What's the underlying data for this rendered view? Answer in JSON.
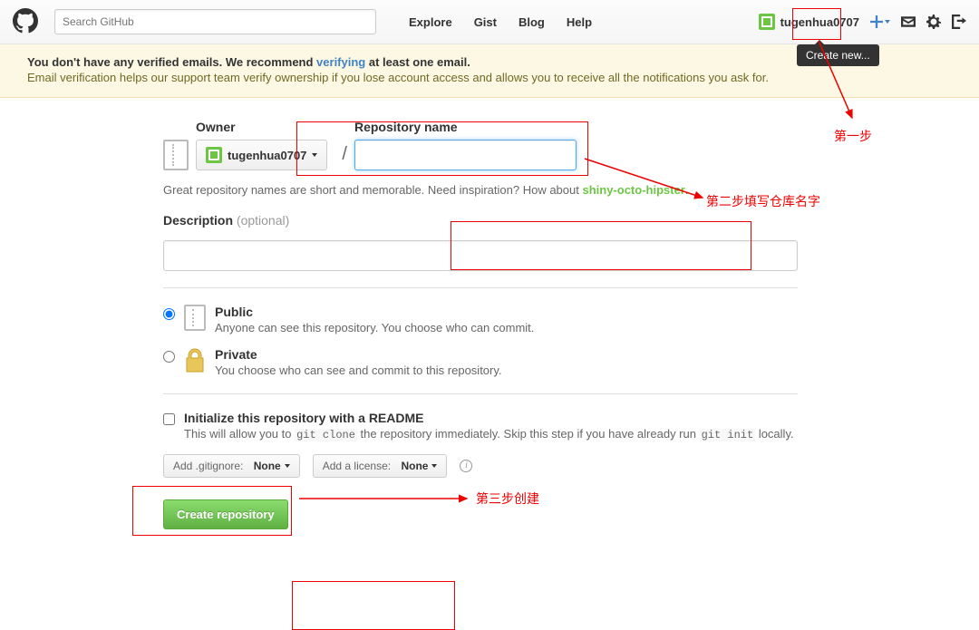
{
  "header": {
    "search_placeholder": "Search GitHub",
    "nav": [
      "Explore",
      "Gist",
      "Blog",
      "Help"
    ],
    "username": "tugenhua0707",
    "tooltip_text": "Create new..."
  },
  "flash": {
    "title_prefix": "You don't have any verified emails. We recommend ",
    "title_link": "verifying",
    "title_suffix": " at least one email.",
    "subtitle": "Email verification helps our support team verify ownership if you lose account access and allows you to receive all the notifications you ask for."
  },
  "form": {
    "owner_label": "Owner",
    "repo_name_label": "Repository name",
    "owner_value": "tugenhua0707",
    "slash": "/",
    "hint_prefix": "Great repository names are short and memorable. Need inspiration? How about ",
    "hint_link": "shiny-octo-hipster",
    "hint_suffix": ".",
    "desc_label": "Description",
    "desc_optional": "(optional)",
    "public": {
      "title": "Public",
      "desc": "Anyone can see this repository. You choose who can commit."
    },
    "private": {
      "title": "Private",
      "desc": "You choose who can see and commit to this repository."
    },
    "readme": {
      "title": "Initialize this repository with a README",
      "desc_pre": "This will allow you to ",
      "code1": "git clone",
      "desc_mid": " the repository immediately. Skip this step if you have already run ",
      "code2": "git init",
      "desc_post": " locally."
    },
    "gitignore_pre": "Add .gitignore:",
    "gitignore_val": "None",
    "license_pre": "Add a license:",
    "license_val": "None",
    "create_button": "Create repository"
  },
  "annotations": {
    "step1": "第一步",
    "step2": "第二步填写仓库名字",
    "step3": "第三步创建"
  }
}
